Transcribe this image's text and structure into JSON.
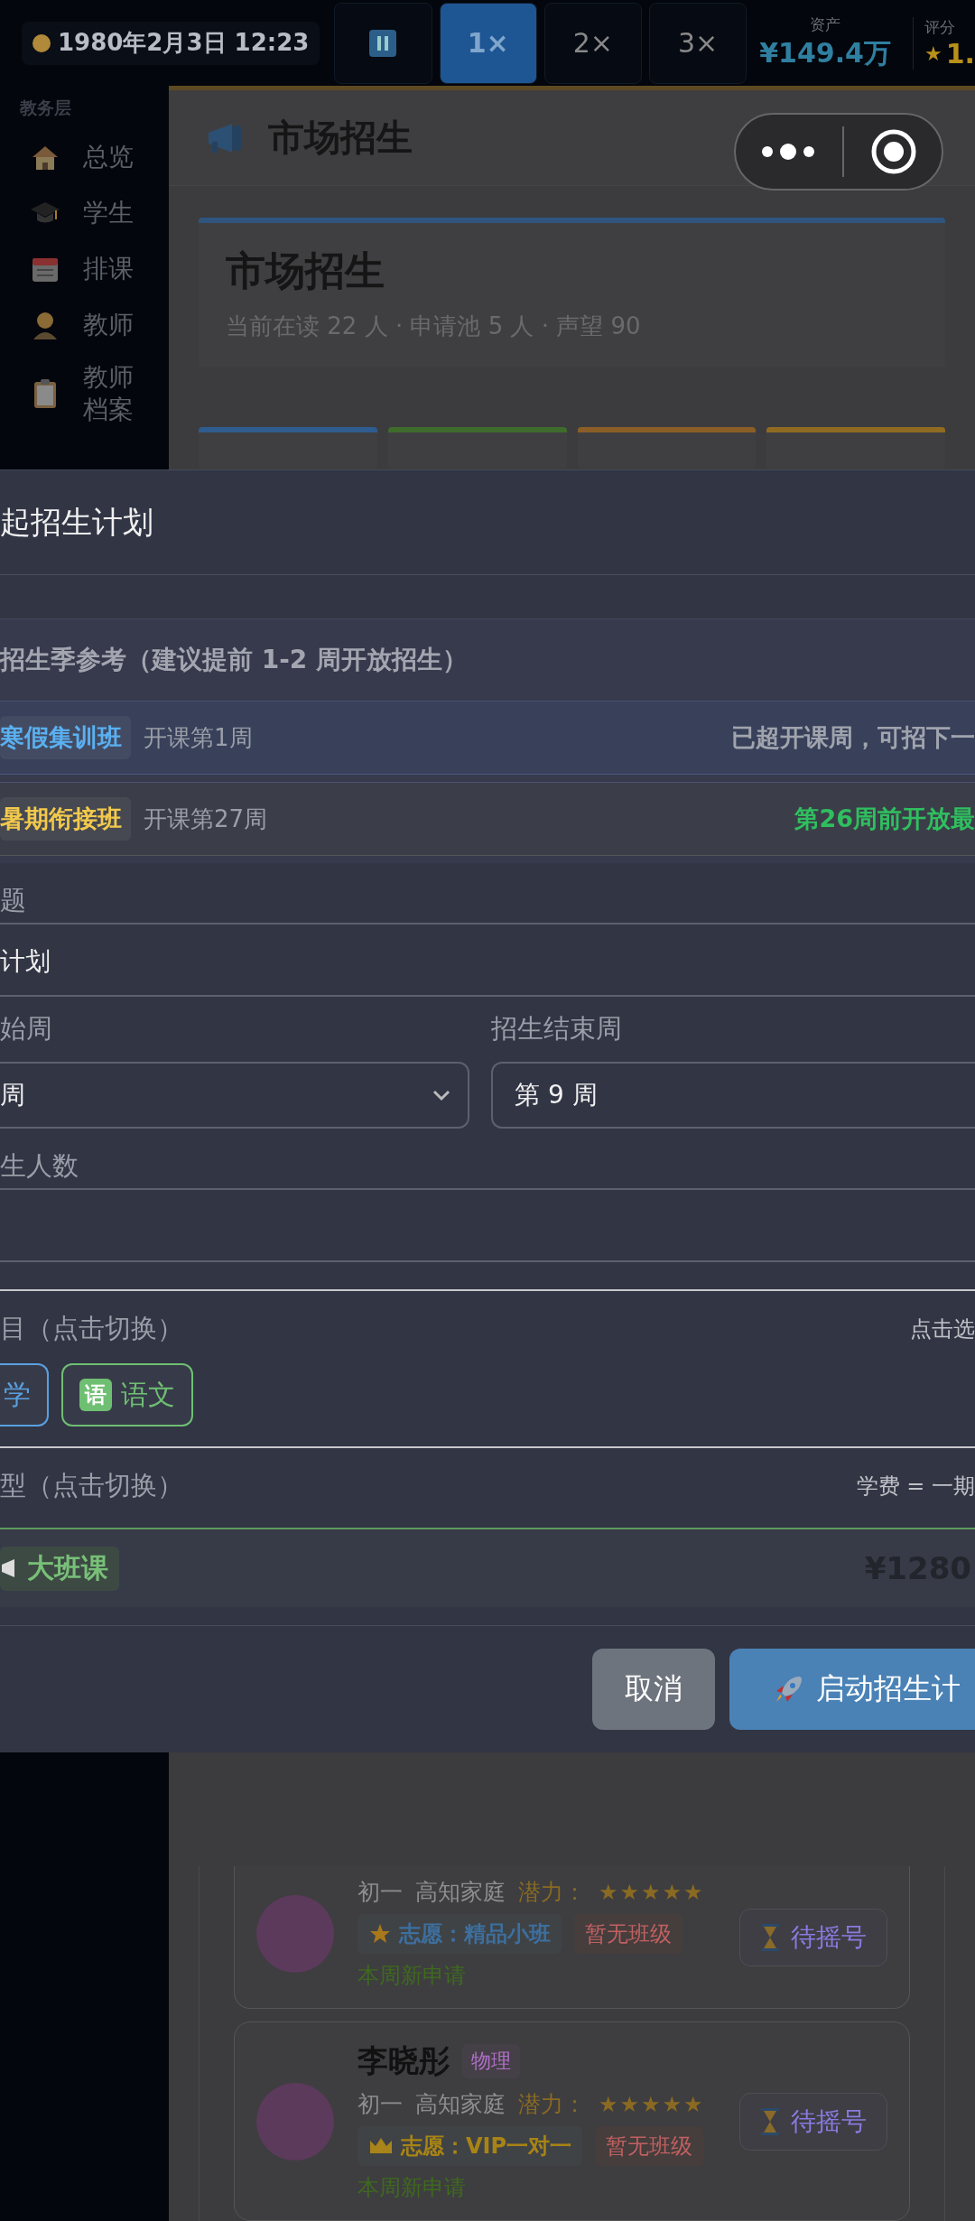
{
  "top_bar": {
    "date": "1980年2月3日 12:23",
    "speed_buttons": [
      {
        "kind": "pause",
        "selected": false
      },
      {
        "kind": "speed",
        "label": "1×",
        "selected": true
      },
      {
        "kind": "speed",
        "label": "2×",
        "selected": false
      },
      {
        "kind": "speed",
        "label": "3×",
        "selected": false
      }
    ],
    "assets": {
      "label": "资产",
      "value": "¥149.4万"
    },
    "rating": {
      "label": "评分",
      "star": "★",
      "value": "1."
    }
  },
  "sidebar": {
    "section": "教务层",
    "items": [
      {
        "label": "总览"
      },
      {
        "label": "学生"
      },
      {
        "label": "排课"
      },
      {
        "label": "教师"
      },
      {
        "label": "教师档案"
      }
    ]
  },
  "header": {
    "title": "市场招生"
  },
  "summary": {
    "title": "市场招生",
    "stats": "当前在读 22 人 · 申请池 5 人 · 声望 90"
  },
  "stat_cards": [
    {
      "color": "#2f5c8f"
    },
    {
      "color": "#3f6b2c"
    },
    {
      "color": "#8a5e26"
    },
    {
      "color": "#8f6b22"
    }
  ],
  "modal": {
    "title": "起招生计划",
    "season": {
      "heading": "招生季参考（建议提前 1-2 周开放招生）",
      "rows": [
        {
          "tag": "寒假集训班",
          "color": "#5ab0f0",
          "start": "开课第1周",
          "note": "已超开课周，可招下一",
          "kind": "passed"
        },
        {
          "tag": "暑期衔接班",
          "color": "#f2c94c",
          "start": "开课第27周",
          "note": "第26周前开放最",
          "kind": "upcoming"
        }
      ]
    },
    "title_field": {
      "label": "题",
      "value": "计划"
    },
    "start_week": {
      "label": "始周",
      "value": "周"
    },
    "end_week": {
      "label": "招生结束周",
      "value": "第 9 周"
    },
    "count_field": {
      "label": "生人数"
    },
    "subjects": {
      "label": "目（点击切换）",
      "hint": "点击选",
      "chips": [
        {
          "label": "学",
          "color": "#5aa0e0"
        },
        {
          "label": "语文",
          "color": "#6fbf73",
          "badge": "语"
        }
      ]
    },
    "class_types": {
      "label": "型（点击切换）",
      "hint": "学费 = 一期",
      "cards": [
        {
          "tag": "大班课",
          "price": "¥1280",
          "selected": true
        }
      ]
    },
    "buttons": [
      {
        "kind": "cancel",
        "label": "取消"
      },
      {
        "kind": "primary",
        "label": "启动招生计"
      }
    ]
  },
  "students": [
    {
      "grade": "初一",
      "family": "高知家庭",
      "potential": "潜力：",
      "stars": 5,
      "wish": {
        "kind": "star",
        "text": "志愿：精品小班"
      },
      "class_status": "暂无班级",
      "note": "本周新申请",
      "action": "待摇号"
    },
    {
      "name": "李晓彤",
      "subject": "物理",
      "grade": "初一",
      "family": "高知家庭",
      "potential": "潜力：",
      "stars": 5,
      "wish": {
        "kind": "crown",
        "text": "志愿：VIP一对一"
      },
      "class_status": "暂无班级",
      "note": "本周新申请",
      "action": "待摇号"
    }
  ]
}
